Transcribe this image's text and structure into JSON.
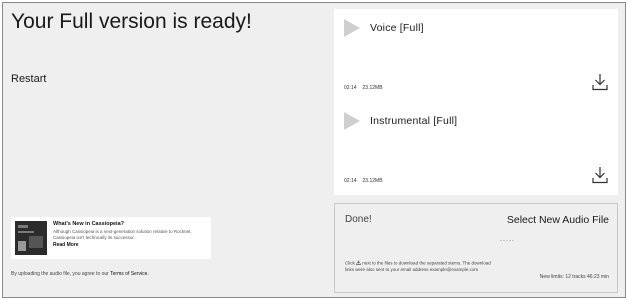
{
  "left": {
    "headline": "Your Full version is ready!",
    "restart_label": "Restart",
    "news": {
      "title": "What's New in Cassiopeia?",
      "body": "Although Cassiopeia is a next-generation solution relative to Rocknet, Cassiopeia isn't technically its successor.",
      "more_label": "Read More"
    },
    "terms_prefix": "By uploading the audio file, you agree to our ",
    "terms_link": "Terms of Service."
  },
  "tracks": [
    {
      "title": "Voice [Full]",
      "duration": "02:14",
      "size": "23.12MB",
      "icon": "download-icon"
    },
    {
      "title": "Instrumental  [Full]",
      "duration": "02:14",
      "size": "23.12MB",
      "icon": "download-icon"
    }
  ],
  "done_panel": {
    "done_label": "Done!",
    "select_label": "Select New Audio File",
    "dashes": "-----",
    "info_prefix": "Click",
    "info_rest": "next to the files to download the separated stems. The download links were also sent to your email address example@example.com",
    "limits": "New limits: 12 tracks 46:23 min"
  }
}
